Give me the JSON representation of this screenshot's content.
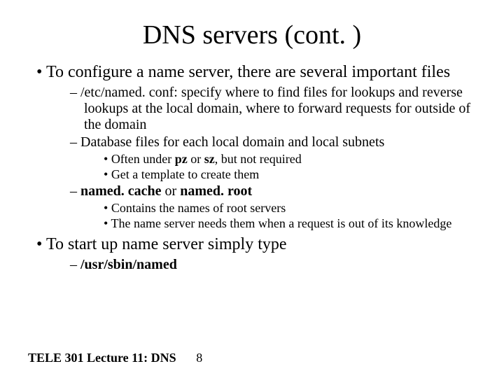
{
  "title": "DNS servers (cont. )",
  "bullets": {
    "b1": "To configure a name server, there are several important files",
    "b1s1": "/etc/named. conf: specify where to find files for lookups and reverse lookups at the local domain, where to forward requests for outside of the domain",
    "b1s2": "Database files for each local domain and local subnets",
    "b1s2a_pre": "Often under ",
    "b1s2a_b1": "pz",
    "b1s2a_mid": " or ",
    "b1s2a_b2": "sz",
    "b1s2a_post": ", but not required",
    "b1s2b": "Get a template to create them",
    "b1s3_b1": "named. cache",
    "b1s3_mid": " or ",
    "b1s3_b2": "named. root",
    "b1s3a": "Contains the names of root servers",
    "b1s3b": "The name server needs them when a request is out of its knowledge",
    "b2": "To start up name server simply type",
    "b2s1": "/usr/sbin/named"
  },
  "footer": {
    "text": "TELE 301 Lecture 11: DNS",
    "page": "8"
  }
}
